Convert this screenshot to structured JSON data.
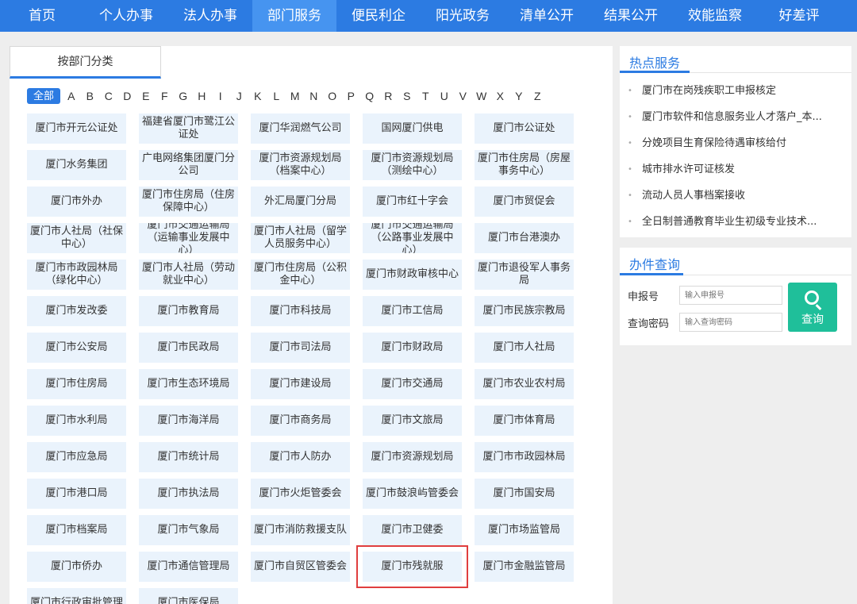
{
  "nav": [
    "首页",
    "个人办事",
    "法人办事",
    "部门服务",
    "便民利企",
    "阳光政务",
    "清单公开",
    "结果公开",
    "效能监察",
    "好差评"
  ],
  "nav_active_index": 3,
  "category_tab": "按部门分类",
  "letters": {
    "all": "全部",
    "list": [
      "A",
      "B",
      "C",
      "D",
      "E",
      "F",
      "G",
      "H",
      "I",
      "J",
      "K",
      "L",
      "M",
      "N",
      "O",
      "P",
      "Q",
      "R",
      "S",
      "T",
      "U",
      "V",
      "W",
      "X",
      "Y",
      "Z"
    ]
  },
  "departments": [
    [
      "厦门市开元公证处",
      "福建省厦门市鹭江公证处",
      "厦门华润燃气公司",
      "国网厦门供电",
      "厦门市公证处"
    ],
    [
      "厦门水务集团",
      "广电网络集团厦门分公司",
      "厦门市资源规划局（档案中心）",
      "厦门市资源规划局（测绘中心）",
      "厦门市住房局（房屋事务中心）"
    ],
    [
      "厦门市外办",
      "厦门市住房局（住房保障中心）",
      "外汇局厦门分局",
      "厦门市红十字会",
      "厦门市贸促会"
    ],
    [
      "厦门市人社局（社保中心）",
      "厦门市交通运输局（运输事业发展中心）",
      "厦门市人社局（留学人员服务中心）",
      "厦门市交通运输局（公路事业发展中心）",
      "厦门市台港澳办"
    ],
    [
      "厦门市市政园林局（绿化中心）",
      "厦门市人社局（劳动就业中心）",
      "厦门市住房局（公积金中心）",
      "厦门市财政审核中心",
      "厦门市退役军人事务局"
    ],
    [
      "厦门市发改委",
      "厦门市教育局",
      "厦门市科技局",
      "厦门市工信局",
      "厦门市民族宗教局"
    ],
    [
      "厦门市公安局",
      "厦门市民政局",
      "厦门市司法局",
      "厦门市财政局",
      "厦门市人社局"
    ],
    [
      "厦门市住房局",
      "厦门市生态环境局",
      "厦门市建设局",
      "厦门市交通局",
      "厦门市农业农村局"
    ],
    [
      "厦门市水利局",
      "厦门市海洋局",
      "厦门市商务局",
      "厦门市文旅局",
      "厦门市体育局"
    ],
    [
      "厦门市应急局",
      "厦门市统计局",
      "厦门市人防办",
      "厦门市资源规划局",
      "厦门市市政园林局"
    ],
    [
      "厦门市港口局",
      "厦门市执法局",
      "厦门市火炬管委会",
      "厦门市鼓浪屿管委会",
      "厦门市国安局"
    ],
    [
      "厦门市档案局",
      "厦门市气象局",
      "厦门市消防救援支队",
      "厦门市卫健委",
      "厦门市场监管局"
    ],
    [
      "厦门市侨办",
      "厦门市通信管理局",
      "厦门市自贸区管委会",
      "厦门市残就服",
      "厦门市金融监管局"
    ],
    [
      "厦门市行政审批管理",
      "厦门市医保局"
    ]
  ],
  "highlighted_department": "厦门市残就服",
  "hot_services": {
    "title": "热点服务",
    "items": [
      "厦门市在岗残疾职工申报核定",
      "厦门市软件和信息服务业人才落户_本...",
      "分娩项目生育保险待遇审核给付",
      "城市排水许可证核发",
      "流动人员人事档案接收",
      "全日制普通教育毕业生初级专业技术..."
    ]
  },
  "query": {
    "title": "办件查询",
    "number_label": "申报号",
    "number_placeholder": "输入申报号",
    "password_label": "查询密码",
    "password_placeholder": "输入查询密码",
    "button_label": "查询"
  },
  "colors": {
    "nav_bg": "#2c7be2",
    "nav_active": "#4694f0",
    "cell_bg": "#eaf3fc",
    "query_btn": "#1fbf9a",
    "highlight": "#e03e3e"
  }
}
